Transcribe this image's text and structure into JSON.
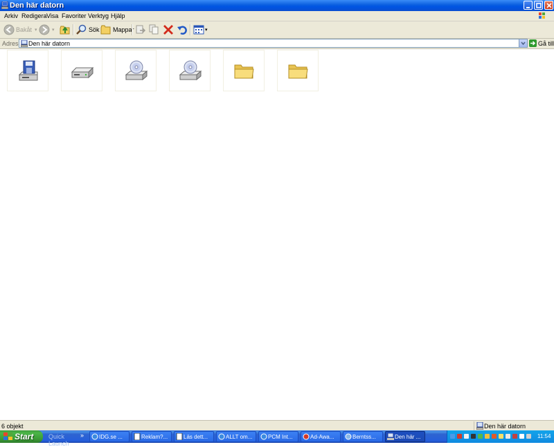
{
  "window": {
    "title": "Den här datorn"
  },
  "menu": [
    "Arkiv",
    "Redigera",
    "Visa",
    "Favoriter",
    "Verktyg",
    "Hjälp"
  ],
  "toolbar": {
    "back_label": "Bakåt",
    "search_label": "Sök",
    "folders_label": "Mappar"
  },
  "address": {
    "label": "Adress",
    "value": "Den här datorn",
    "go_label": "Gå till"
  },
  "items": [
    {
      "icon": "floppy-drive-icon"
    },
    {
      "icon": "hard-drive-icon"
    },
    {
      "icon": "cd-drive-icon"
    },
    {
      "icon": "cd-drive-icon"
    },
    {
      "icon": "folder-icon"
    },
    {
      "icon": "folder-icon"
    }
  ],
  "status": {
    "count": "6 objekt",
    "zone": "Den här datorn"
  },
  "taskbar": {
    "start_label": "Start",
    "quicklaunch_label": "Quick Launch",
    "tasks": [
      "IDG.se ...",
      "Reklam?...",
      "Läs dett...",
      "ALLT om...",
      "PCM Int...",
      "Ad-Awa...",
      "Berntss...",
      "Den här ..."
    ],
    "clock": "11:54"
  },
  "colors": {
    "titlebar": "#0054e3",
    "taskbar": "#245edb",
    "start": "#3a9a35",
    "chrome": "#ece9d8"
  }
}
